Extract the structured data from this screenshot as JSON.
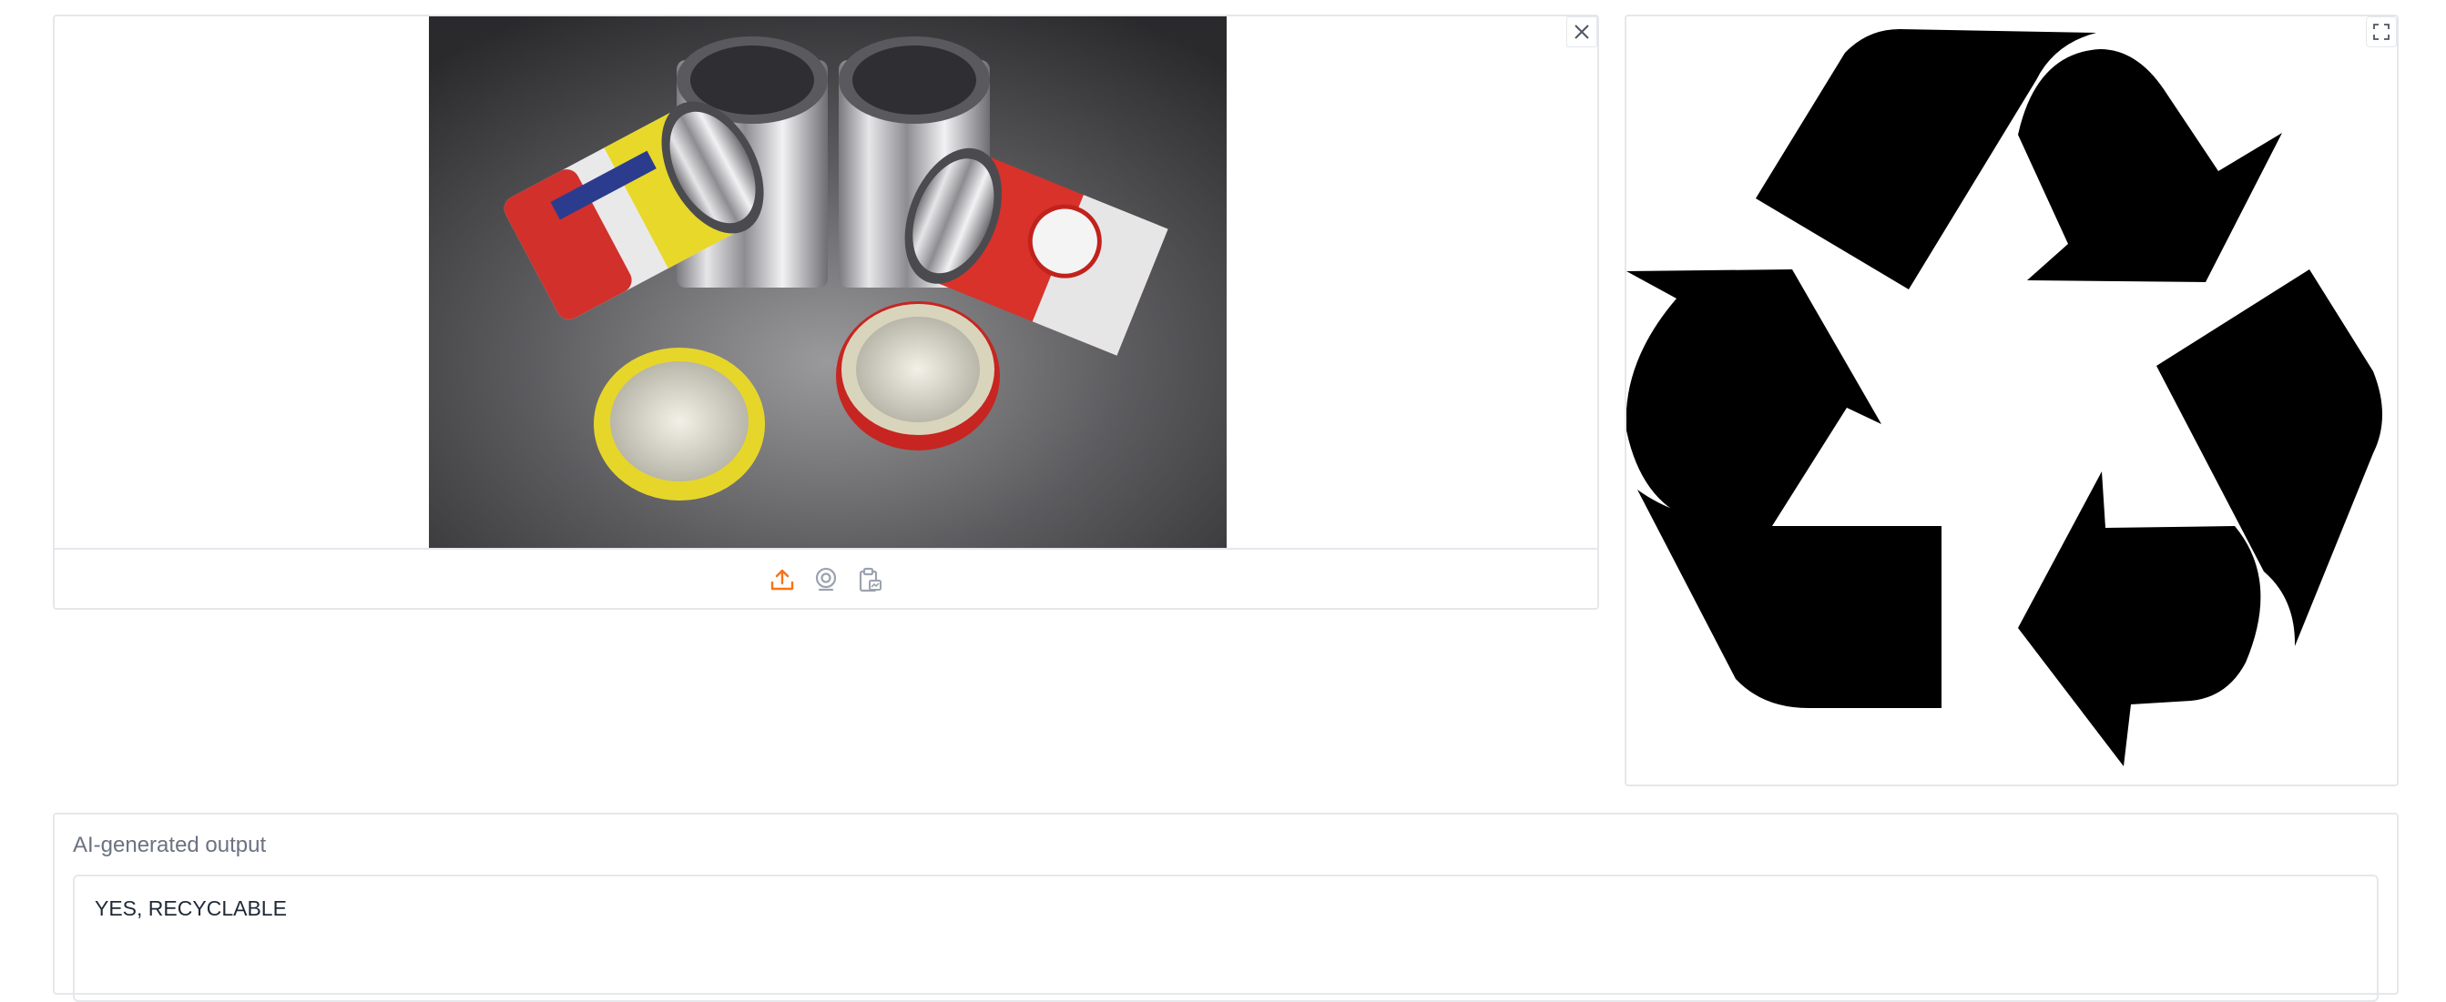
{
  "input": {
    "photo_alt": "Tin cans with lids",
    "close_icon": "close-icon",
    "sources": [
      {
        "icon": "upload-icon",
        "color": "#f97316"
      },
      {
        "icon": "webcam-icon",
        "color": "#9ca3af"
      },
      {
        "icon": "clipboard-icon",
        "color": "#9ca3af"
      }
    ]
  },
  "output_image": {
    "icon": "recycle-icon",
    "fullscreen_icon": "fullscreen-icon"
  },
  "output_text": {
    "label": "AI-generated output",
    "value": "YES, RECYCLABLE"
  },
  "colors": {
    "accent": "#f97316",
    "border": "#e5e7eb",
    "muted": "#6b7280"
  }
}
